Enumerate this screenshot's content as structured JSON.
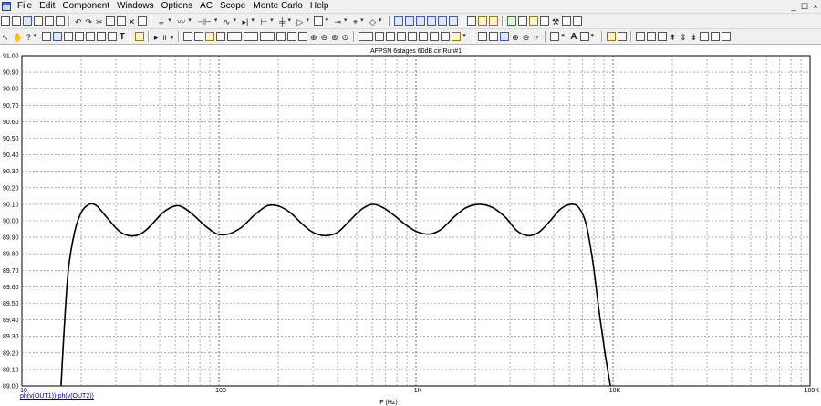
{
  "menu": {
    "items": [
      "File",
      "Edit",
      "Component",
      "Windows",
      "Options",
      "AC",
      "Scope",
      "Monte Carlo",
      "Help"
    ],
    "window_controls": [
      "_",
      "☐",
      "×"
    ]
  },
  "toolbar2": {
    "text_tool": "T",
    "font_tool": "A"
  },
  "chart_data": {
    "type": "line",
    "title": "AFPSN 6stages 60dB.cir Run#1",
    "xlabel": "F (Hz)",
    "ylabel": "",
    "x_scale": "log",
    "xlim": [
      10,
      100000
    ],
    "ylim": [
      89.0,
      91.0
    ],
    "x_ticks": [
      {
        "value": 10,
        "label": "10"
      },
      {
        "value": 100,
        "label": "100"
      },
      {
        "value": 1000,
        "label": "1K"
      },
      {
        "value": 10000,
        "label": "10K"
      },
      {
        "value": 100000,
        "label": "100K"
      }
    ],
    "y_ticks": [
      "89.00",
      "89.10",
      "89.20",
      "89.30",
      "89.40",
      "89.50",
      "89.60",
      "89.70",
      "89.80",
      "89.90",
      "90.00",
      "90.10",
      "90.20",
      "90.30",
      "90.40",
      "90.50",
      "90.60",
      "90.70",
      "90.80",
      "90.90",
      "91.00"
    ],
    "grid": true,
    "series": [
      {
        "name": "ph(v(OUT1))-ph(v(OUT2))",
        "color": "#000000",
        "points": [
          [
            15.8,
            89.0
          ],
          [
            16.4,
            89.35
          ],
          [
            17.2,
            89.7
          ],
          [
            18.5,
            89.93
          ],
          [
            20,
            90.05
          ],
          [
            22,
            90.1
          ],
          [
            24,
            90.09
          ],
          [
            27,
            90.02
          ],
          [
            31,
            89.94
          ],
          [
            35,
            89.91
          ],
          [
            40,
            89.92
          ],
          [
            45,
            89.97
          ],
          [
            52,
            90.05
          ],
          [
            60,
            90.09
          ],
          [
            66,
            90.08
          ],
          [
            75,
            90.03
          ],
          [
            85,
            89.97
          ],
          [
            98,
            89.92
          ],
          [
            112,
            89.92
          ],
          [
            130,
            89.96
          ],
          [
            150,
            90.03
          ],
          [
            175,
            90.09
          ],
          [
            200,
            90.09
          ],
          [
            230,
            90.05
          ],
          [
            265,
            89.98
          ],
          [
            300,
            89.93
          ],
          [
            345,
            89.91
          ],
          [
            400,
            89.93
          ],
          [
            460,
            90.0
          ],
          [
            530,
            90.07
          ],
          [
            600,
            90.1
          ],
          [
            680,
            90.08
          ],
          [
            780,
            90.03
          ],
          [
            900,
            89.97
          ],
          [
            1030,
            89.93
          ],
          [
            1180,
            89.92
          ],
          [
            1350,
            89.95
          ],
          [
            1550,
            90.02
          ],
          [
            1800,
            90.08
          ],
          [
            2100,
            90.1
          ],
          [
            2450,
            90.08
          ],
          [
            2850,
            90.02
          ],
          [
            3250,
            89.94
          ],
          [
            3700,
            89.91
          ],
          [
            4200,
            89.93
          ],
          [
            4800,
            90.0
          ],
          [
            5400,
            90.07
          ],
          [
            6100,
            90.1
          ],
          [
            6700,
            90.08
          ],
          [
            7300,
            89.98
          ],
          [
            7900,
            89.75
          ],
          [
            8500,
            89.45
          ],
          [
            9100,
            89.2
          ],
          [
            9700,
            89.0
          ]
        ]
      }
    ]
  }
}
